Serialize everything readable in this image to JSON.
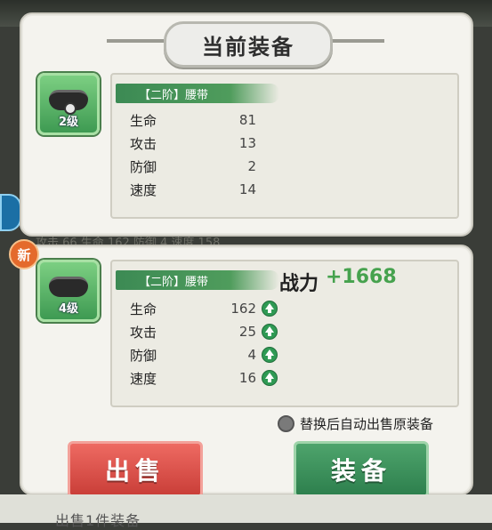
{
  "title": "当前装备",
  "current_item": {
    "name": "【二阶】腰带",
    "level": "2级",
    "stats": [
      {
        "label": "生命",
        "value": "81"
      },
      {
        "label": "攻击",
        "value": "13"
      },
      {
        "label": "防御",
        "value": "2"
      },
      {
        "label": "速度",
        "value": "14"
      }
    ]
  },
  "new_item": {
    "badge": "新",
    "name": "【二阶】腰带",
    "level": "4级",
    "power_label": "战力",
    "power_value": "+1668",
    "stats": [
      {
        "label": "生命",
        "value": "162",
        "improved": true
      },
      {
        "label": "攻击",
        "value": "25",
        "improved": true
      },
      {
        "label": "防御",
        "value": "4",
        "improved": true
      },
      {
        "label": "速度",
        "value": "16",
        "improved": true
      }
    ]
  },
  "auto_sell_label": "替换后自动出售原装备",
  "buttons": {
    "sell": "出售",
    "equip": "装备"
  },
  "background": {
    "bottom_text": "出售1件装备",
    "behind_row": "攻击 66      生命 162      防御 4      速度 158"
  },
  "colors": {
    "power_value": "#46a24e",
    "sell_button": "#d84a43",
    "equip_button": "#3a9160"
  }
}
